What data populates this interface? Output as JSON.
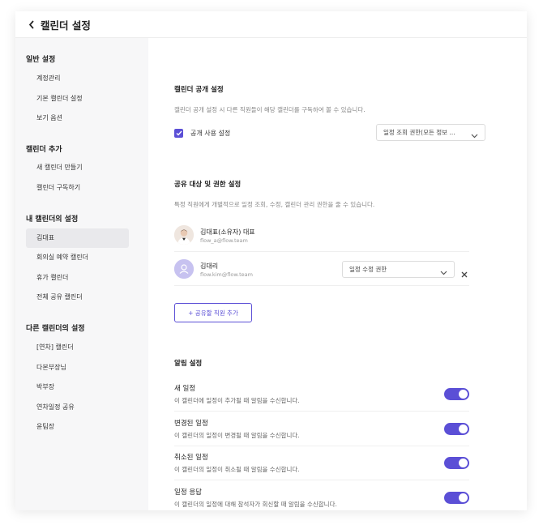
{
  "header": {
    "title": "캘린더 설정"
  },
  "sidebar": {
    "sections": [
      {
        "title": "일반 설정",
        "items": [
          "계정관리",
          "기본 캘린더 설정",
          "보기 옵션"
        ]
      },
      {
        "title": "캘린더 추가",
        "items": [
          "새 캘린더 만들기",
          "캘린더 구독하기"
        ]
      },
      {
        "title": "내 캘린더의 설정",
        "items": [
          "김대표",
          "회의실 예약 캘린더",
          "휴가 캘린더",
          "전체 공유 캘린더"
        ]
      },
      {
        "title": "다른 캘린더의 설정",
        "items": [
          "[연차] 캘린더",
          "다본부장님",
          "박부장",
          "연차일정 공유",
          "윤팀장"
        ]
      }
    ],
    "active_item": "김대표"
  },
  "public": {
    "title": "캘린더 공개 설정",
    "desc": "캘린더 공개 설정 시 다른 직원들이 해당 캘린더를 구독하여 볼 수 있습니다.",
    "checkbox_label": "공개 사용 설정",
    "checkbox_checked": true,
    "select_value": "일정 조회 권한(모든 정보 ..."
  },
  "sharing": {
    "title": "공유 대상 및 권한 설정",
    "desc": "특정 직원에게 개별적으로 일정 조회, 수정, 캘린더 관리 권한을 줄 수 있습니다.",
    "users": [
      {
        "name": "김대표(소유자) 대표",
        "email": "flow_a@flow.team"
      },
      {
        "name": "김대리",
        "email": "flow.kim@flow.team",
        "permission": "일정 수정 권한"
      }
    ],
    "add_button": "+ 공유할 직원 추가"
  },
  "notifications": {
    "title": "알림 설정",
    "items": [
      {
        "title": "새 일정",
        "desc": "이 캘린더에 일정이 추가될 때 알림을 수신합니다.",
        "enabled": true
      },
      {
        "title": "변경된 일정",
        "desc": "이 캘린더의 일정이 변경될 때 알림을 수신합니다.",
        "enabled": true
      },
      {
        "title": "취소된 일정",
        "desc": "이 캘린더의 일정이 취소될 때 알림을 수신합니다.",
        "enabled": true
      },
      {
        "title": "일정 응답",
        "desc": "이 캘린더의 일정에 대해 참석자가 회신할 때 알림을 수신합니다.",
        "enabled": true
      }
    ]
  },
  "colors": {
    "accent": "#5b4fd6",
    "sidebar_bg": "#f7f7f8",
    "active_bg": "#e9e9ec"
  }
}
